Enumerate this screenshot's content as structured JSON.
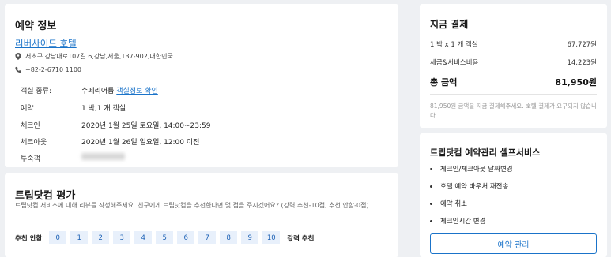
{
  "booking": {
    "title": "예약 정보",
    "hotel_name": "리버사이드 호텔",
    "address": "서초구 강남대로107길 6,강남,서울,137-902,대한민국",
    "phone": "+82-2-6710 1100",
    "rows": [
      {
        "key": "객실 종류:",
        "value": "수페리어룸",
        "link": "객실정보 확인"
      },
      {
        "key": "예약",
        "value": "1 박,1 개 객실"
      },
      {
        "key": "체크인",
        "value": "2020년 1월 25일 토요일, 14:00~23:59"
      },
      {
        "key": "체크아웃",
        "value": "2020년 1월 26일 일요일, 12:00 이전"
      },
      {
        "key": "투숙객",
        "value": ""
      }
    ]
  },
  "rating": {
    "title": "트립닷컴 평가",
    "description": "트립닷컴 서비스에 대해 리뷰를 작성해주세요. 친구에게 트립닷컴을 추천한다면 몇 점을 주시겠어요? (강력 추천-10점, 추천 안함-0점)",
    "low_label": "추천 안함",
    "high_label": "강력 추천",
    "scores": [
      "0",
      "1",
      "2",
      "3",
      "4",
      "5",
      "6",
      "7",
      "8",
      "9",
      "10"
    ]
  },
  "payment": {
    "title": "지금 결제",
    "lines": [
      {
        "label": "1 박 x 1 개 객실",
        "amount": "67,727원"
      },
      {
        "label": "세금&서비스비용",
        "amount": "14,223원"
      }
    ],
    "total_label": "총 금액",
    "total_amount": "81,950원",
    "note": "81,950원 금액을 지금 결제해주세요. 호텔 결제가 요구되지 않습니다."
  },
  "manage": {
    "title": "트립닷컴 예약관리 셀프서비스",
    "items": [
      "체크인/체크아웃 날짜변경",
      "호텔 예약 바우처 재전송",
      "예약 취소",
      "체크인시간 변경"
    ],
    "button_label": "예약 관리"
  }
}
